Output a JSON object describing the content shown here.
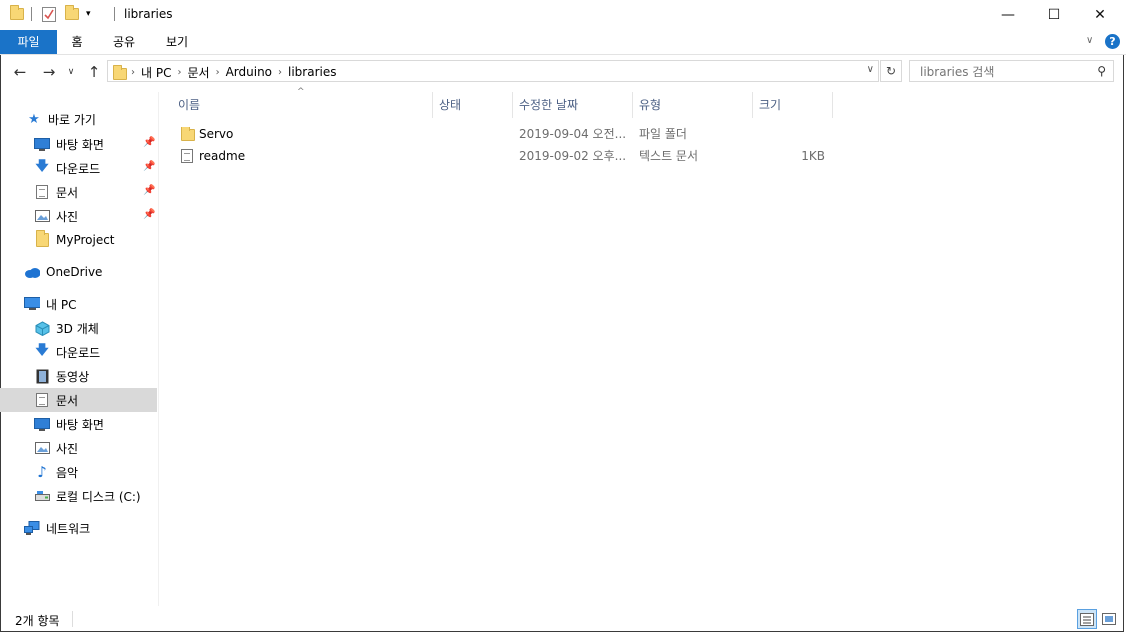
{
  "window": {
    "title": "libraries",
    "controls": {
      "minimize": "—",
      "maximize": "☐",
      "close": "✕"
    }
  },
  "ribbon": {
    "tabs": [
      {
        "label": "파일",
        "active": true
      },
      {
        "label": "홈",
        "active": false
      },
      {
        "label": "공유",
        "active": false
      },
      {
        "label": "보기",
        "active": false
      }
    ]
  },
  "address": {
    "breadcrumbs": [
      "내 PC",
      "문서",
      "Arduino",
      "libraries"
    ]
  },
  "search": {
    "placeholder": "libraries 검색"
  },
  "nav": {
    "quick_access": "바로 가기",
    "quick_items": [
      "바탕 화면",
      "다운로드",
      "문서",
      "사진",
      "MyProject"
    ],
    "onedrive": "OneDrive",
    "this_pc": "내 PC",
    "pc_items": [
      "3D 개체",
      "다운로드",
      "동영상",
      "문서",
      "바탕 화면",
      "사진",
      "음악",
      "로컬 디스크 (C:)"
    ],
    "network": "네트워크",
    "selected": "문서"
  },
  "columns": [
    "이름",
    "상태",
    "수정한 날짜",
    "유형",
    "크기"
  ],
  "files": [
    {
      "name": "Servo",
      "status": "",
      "modified": "2019-09-04 오전...",
      "type": "파일 폴더",
      "size": "",
      "icon": "folder-icon"
    },
    {
      "name": "readme",
      "status": "",
      "modified": "2019-09-02 오후...",
      "type": "텍스트 문서",
      "size": "1KB",
      "icon": "text-file-icon"
    }
  ],
  "status": {
    "item_count": "2개 항목"
  },
  "colors": {
    "accent": "#1a73c8",
    "selection": "#d9d9d9",
    "header_text": "#4d6185"
  }
}
